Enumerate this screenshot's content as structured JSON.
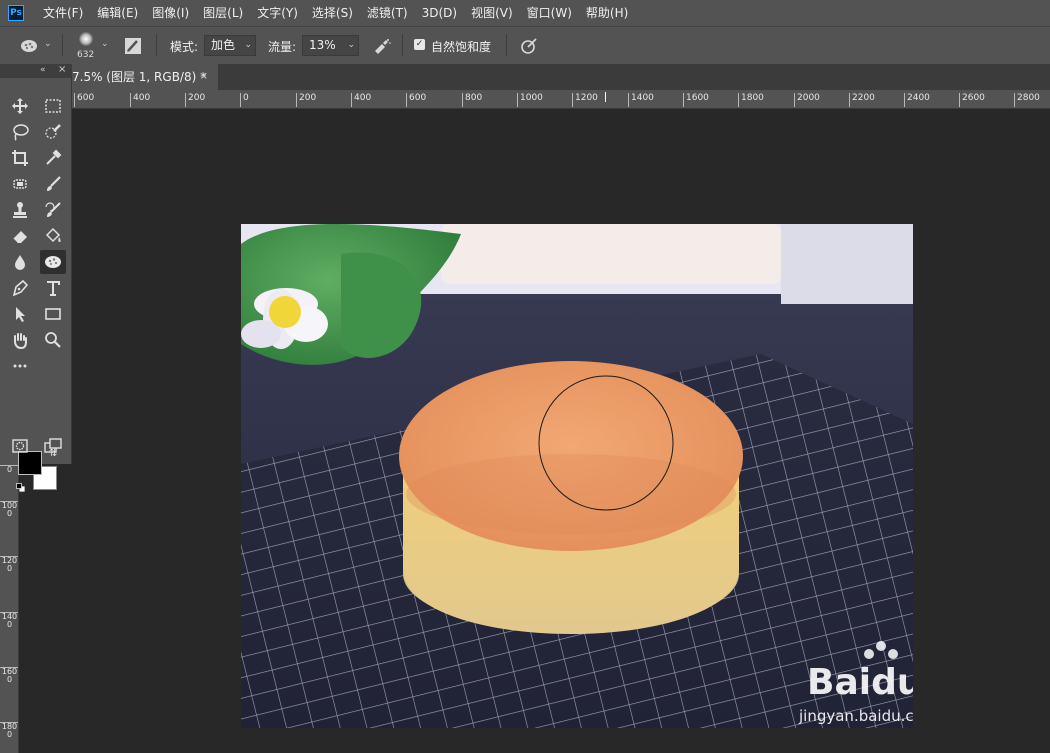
{
  "app": {
    "logo_text": "Ps"
  },
  "menu": [
    "文件(F)",
    "编辑(E)",
    "图像(I)",
    "图层(L)",
    "文字(Y)",
    "选择(S)",
    "滤镜(T)",
    "3D(D)",
    "视图(V)",
    "窗口(W)",
    "帮助(H)"
  ],
  "options": {
    "brush_size": "632",
    "mode_label": "模式:",
    "mode_value": "加色",
    "flow_label": "流量:",
    "flow_value": "13%",
    "natural_saturation_label": "自然饱和度",
    "natural_saturation_checked": true
  },
  "document_tab": {
    "title": "7.5% (图层 1, RGB/8) *",
    "close": "×"
  },
  "ruler_h": [
    "600",
    "400",
    "200",
    "0",
    "200",
    "400",
    "600",
    "800",
    "1000",
    "1200",
    "1400",
    "1600",
    "1800",
    "2000",
    "2200",
    "2400",
    "2600",
    "2800"
  ],
  "ruler_v": [
    "0",
    "1000",
    "1200",
    "1400",
    "1600",
    "1800"
  ],
  "colors": {
    "foreground": "#000000",
    "background": "#ffffff",
    "ui_bg": "#535353",
    "canvas_bg": "#282828"
  },
  "watermark": {
    "brand": "Baidu经验",
    "url": "jingyan.baidu.com"
  }
}
